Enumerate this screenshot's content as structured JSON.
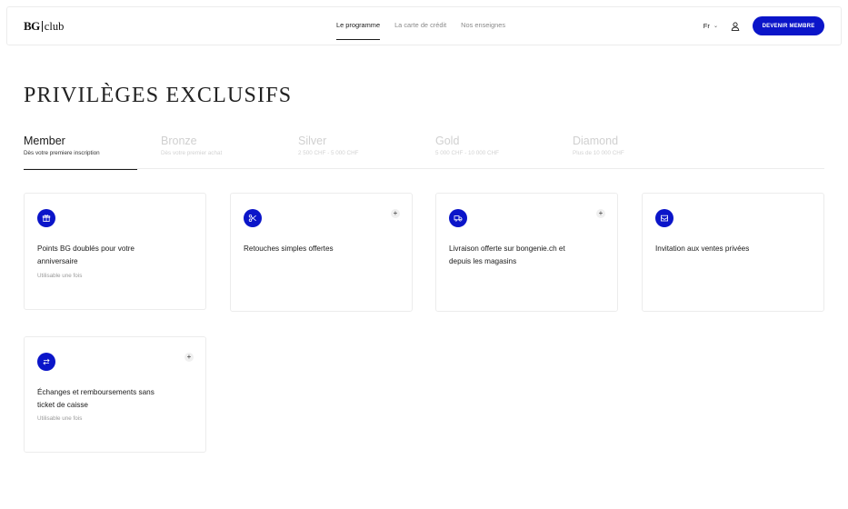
{
  "header": {
    "logo_bg": "BG",
    "logo_club": "club",
    "nav": [
      "Le programme",
      "La carte de crédit",
      "Nos enseignes"
    ],
    "lang": "Fr",
    "cta": "DEVENIR MEMBRE",
    "icons": {
      "lang_chevron": "chevron-down-icon",
      "user": "user-icon"
    }
  },
  "page": {
    "title": "PRIVILÈGES EXCLUSIFS"
  },
  "tiers": [
    {
      "name": "Member",
      "sub": "Dès votre premiere inscription",
      "active": true
    },
    {
      "name": "Bronze",
      "sub": "Dès votre premier achat",
      "active": false
    },
    {
      "name": "Silver",
      "sub": "2 500 CHF - 5 000 CHF",
      "active": false
    },
    {
      "name": "Gold",
      "sub": "5 000 CHF - 10 000 CHF",
      "active": false
    },
    {
      "name": "Diamond",
      "sub": "Plus de 10 000 CHF",
      "active": false
    }
  ],
  "cards": [
    {
      "icon": "gift-icon",
      "title": "Points BG doublés pour votre anniversaire",
      "note": "Utilisable une fois",
      "plus": false
    },
    {
      "icon": "scissors-icon",
      "title": "Retouches simples offertes",
      "note": "",
      "plus": true
    },
    {
      "icon": "delivery-truck-icon",
      "title": "Livraison offerte sur bongenie.ch et depuis les magasins",
      "note": "",
      "plus": true
    },
    {
      "icon": "mail-invitation-icon",
      "title": "Invitation aux ventes privées",
      "note": "",
      "plus": false
    },
    {
      "icon": "exchange-icon",
      "title": "Échanges et remboursements sans ticket de caisse",
      "note": "Utilisable une fois",
      "plus": true
    }
  ],
  "colors": {
    "accent": "#0b15c9",
    "text": "#1a1a1a",
    "muted": "#9a9a9a",
    "border": "#ececec"
  }
}
